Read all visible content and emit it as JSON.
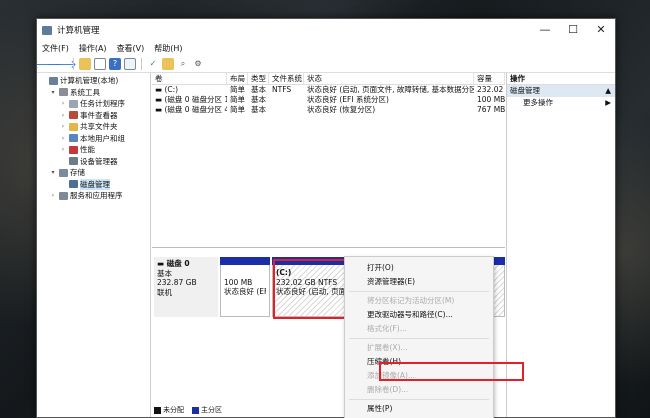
{
  "window": {
    "title": "计算机管理",
    "controls": [
      "—",
      "☐",
      "✕"
    ]
  },
  "menu": [
    "文件(F)",
    "操作(A)",
    "查看(V)",
    "帮助(H)"
  ],
  "tree": [
    {
      "label": "计算机管理(本地)",
      "level": 0,
      "exp": "",
      "icon": "computer-icon",
      "color": "#6a7f99"
    },
    {
      "label": "系统工具",
      "level": 1,
      "exp": "▾",
      "icon": "tools-icon",
      "color": "#8a8f96"
    },
    {
      "label": "任务计划程序",
      "level": 2,
      "exp": "›",
      "icon": "clock-icon",
      "color": "#9aa6b2"
    },
    {
      "label": "事件查看器",
      "level": 2,
      "exp": "›",
      "icon": "event-viewer-icon",
      "color": "#b84a3a"
    },
    {
      "label": "共享文件夹",
      "level": 2,
      "exp": "›",
      "icon": "shared-folder-icon",
      "color": "#e6b54a"
    },
    {
      "label": "本地用户和组",
      "level": 2,
      "exp": "›",
      "icon": "users-icon",
      "color": "#5a86c0"
    },
    {
      "label": "性能",
      "level": 2,
      "exp": "›",
      "icon": "performance-icon",
      "color": "#c23a3a"
    },
    {
      "label": "设备管理器",
      "level": 2,
      "exp": "",
      "icon": "device-manager-icon",
      "color": "#6c7a89"
    },
    {
      "label": "存储",
      "level": 1,
      "exp": "▾",
      "icon": "storage-icon",
      "color": "#7b8b99"
    },
    {
      "label": "磁盘管理",
      "level": 2,
      "exp": "",
      "icon": "disk-management-icon",
      "color": "#4d6f94",
      "selected": true
    },
    {
      "label": "服务和应用程序",
      "level": 1,
      "exp": "›",
      "icon": "services-icon",
      "color": "#7f8a96"
    }
  ],
  "volumes": {
    "headers": [
      "卷",
      "布局",
      "类型",
      "文件系统",
      "状态",
      "容量"
    ],
    "rows": [
      [
        "(C:)",
        "简单",
        "基本",
        "NTFS",
        "状态良好 (启动, 页面文件, 故障转储, 基本数据分区)",
        "232.02"
      ],
      [
        "(磁盘 0 磁盘分区 1)",
        "简单",
        "基本",
        "",
        "状态良好 (EFI 系统分区)",
        "100 MB"
      ],
      [
        "(磁盘 0 磁盘分区 4)",
        "简单",
        "基本",
        "",
        "状态良好 (恢复分区)",
        "767 MB"
      ]
    ]
  },
  "disk": {
    "name": "磁盘 0",
    "type": "基本",
    "size": "232.87 GB",
    "status": "联机",
    "partitions": [
      {
        "title": "",
        "line1": "100 MB",
        "line2": "状态良好 (EFI"
      },
      {
        "title": "(C:)",
        "line1": "232.02 GB NTFS",
        "line2": "状态良好 (启动, 页面文件, 故障转"
      }
    ]
  },
  "legend": [
    "未分配",
    "主分区"
  ],
  "legend_colors": [
    "#111111",
    "#1a2ea8"
  ],
  "actions": {
    "header": "操作",
    "section": "磁盘管理",
    "more": "更多操作"
  },
  "context_menu": [
    {
      "label": "打开(O)",
      "disabled": false
    },
    {
      "label": "资源管理器(E)",
      "disabled": false
    },
    {
      "sep": true
    },
    {
      "label": "将分区标记为活动分区(M)",
      "disabled": true
    },
    {
      "label": "更改驱动器号和路径(C)...",
      "disabled": false
    },
    {
      "label": "格式化(F)...",
      "disabled": true
    },
    {
      "sep": true
    },
    {
      "label": "扩展卷(X)...",
      "disabled": true
    },
    {
      "label": "压缩卷(H)...",
      "disabled": false
    },
    {
      "label": "添加镜像(A)...",
      "disabled": true
    },
    {
      "label": "删除卷(D)...",
      "disabled": true
    },
    {
      "sep": true
    },
    {
      "label": "属性(P)",
      "disabled": false
    }
  ],
  "colors": {
    "highlight": "#e0202a",
    "partition_bar": "#1a2ea8",
    "selection": "#cce4f7"
  }
}
